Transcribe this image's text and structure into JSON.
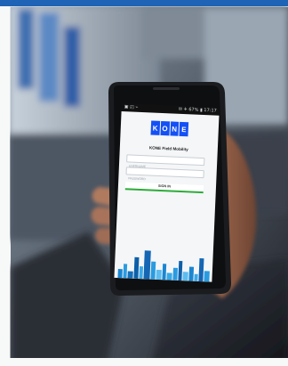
{
  "screen": {
    "status_left": "▣ ◰ ⌁",
    "status_right": "✉ ✈ 67% ▮ 17:17",
    "logo_letters": [
      "K",
      "O",
      "N",
      "E"
    ],
    "app_title": "KONE Field Mobility",
    "username_placeholder": "USERNAME",
    "password_placeholder": "PASSWORD",
    "signin_label": "SIGN IN"
  },
  "colors": {
    "brand_blue": "#1450f5",
    "signin_green": "#2dab3a",
    "top_bar": "#1e63b5"
  }
}
